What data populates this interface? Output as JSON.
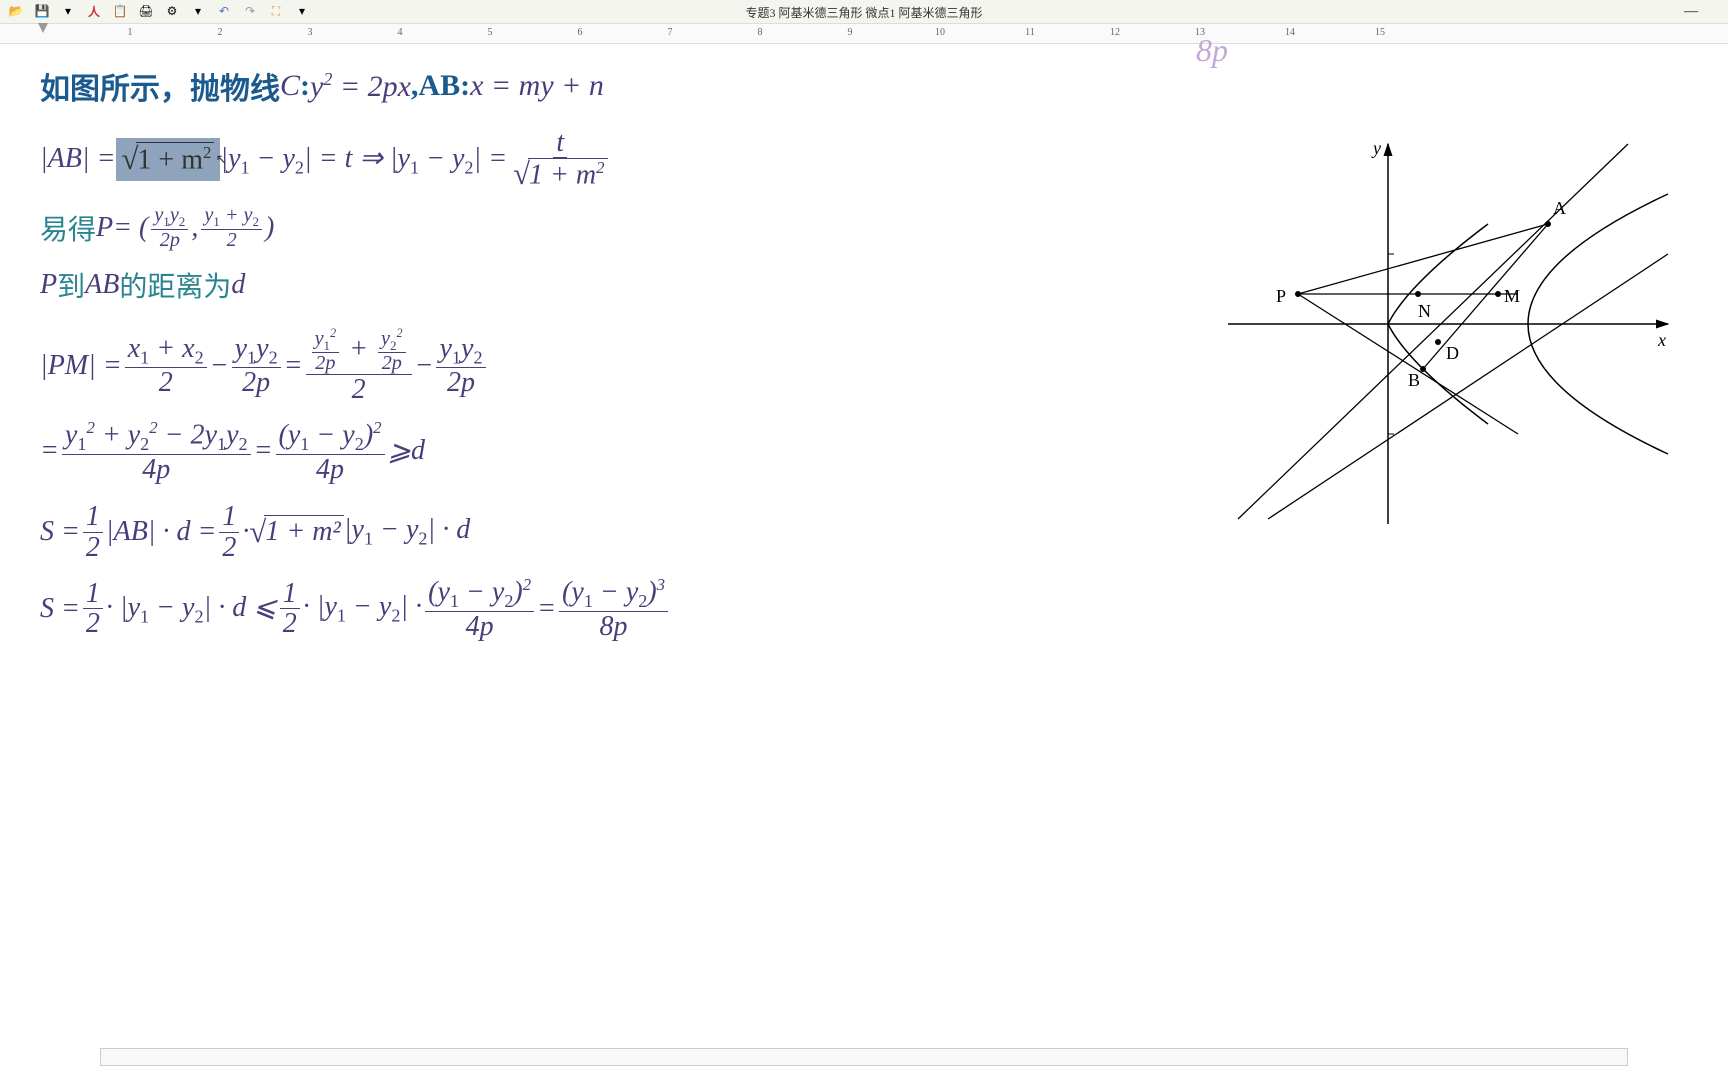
{
  "app": {
    "title": "专题3 阿基米德三角形 微点1 阿基米德三角形",
    "minimize": "—"
  },
  "toolbar": {
    "open": "📂",
    "save": "💾",
    "pdf": "人",
    "copy": "📋",
    "print": "🖨",
    "settings": "⚙",
    "undo": "↶",
    "redo": "↷",
    "expand": "⛶",
    "dropdown": "▾"
  },
  "ruler": {
    "marks": [
      "1",
      "2",
      "3",
      "4",
      "5",
      "6",
      "7",
      "8",
      "9",
      "10",
      "11",
      "12",
      "13",
      "14",
      "15"
    ],
    "offsets": [
      130,
      220,
      310,
      400,
      490,
      580,
      670,
      760,
      850,
      940,
      1030,
      1115,
      1200,
      1290,
      1380
    ]
  },
  "fade": "8p",
  "line1": {
    "prefix": "如图所示，抛物线 ",
    "c_label": "C",
    "colon1": ": ",
    "eq1a": "y",
    "eq1b": " = 2px",
    "sep": ", ",
    "ab": "AB",
    "colon2": ": ",
    "eq2": "x = my + n"
  },
  "line2": {
    "ab": "|AB| = ",
    "root": "1 + m",
    "mid": "|y",
    "dash": " − y",
    "eq": "| = t ⇒ |y",
    "dash2": " − y",
    "end": "| = ",
    "num": "t",
    "den_root": "1 + m"
  },
  "line3": {
    "prefix": "易得 ",
    "p": "P",
    "open": " = (",
    "n1": "y₁y₂",
    "d1": "2p",
    "comma": ", ",
    "n2": "y₁ + y₂",
    "d2": "2",
    "close": ")"
  },
  "line4": {
    "p": "P",
    "mid": " 到 ",
    "ab": "AB",
    "suffix": " 的距离为 ",
    "d": "d"
  },
  "line5": {
    "pm": "|PM| = ",
    "n1": "x₁ + x₂",
    "d1": "2",
    "minus": " − ",
    "n2": "y₁y₂",
    "d2": "2p",
    "eq": " = ",
    "nn1": "y₁²",
    "nd1": "2p",
    "plus": " + ",
    "nn2": "y₂²",
    "nd2": "2p",
    "dd": "2",
    "minus2": " − ",
    "n3": "y₁y₂",
    "d3": "2p"
  },
  "line6": {
    "eq": "= ",
    "n1": "y₁² + y₂² − 2y₁y₂",
    "d1": "4p",
    "eq2": " = ",
    "n2": "(y₁ − y₂)²",
    "d2": "4p",
    "ge": " ⩾ ",
    "d": "d"
  },
  "line7": {
    "s": "S = ",
    "half_n": "1",
    "half_d": "2",
    "ab": "|AB| · d = ",
    "half2_n": "1",
    "half2_d": "2",
    "dot": " · ",
    "root": "1 + m²",
    "yy": "|y₁ − y₂| · d"
  },
  "line8": {
    "s": "S = ",
    "half_n": "1",
    "half_d": "2",
    "dot": " · |y₁ − y₂| · d ⩽ ",
    "half2_n": "1",
    "half2_d": "2",
    "dot2": " · |y₁ − y₂| · ",
    "n1": "(y₁ − y₂)²",
    "d1": "4p",
    "eq": " = ",
    "n2": "(y₁ − y₂)³",
    "d2": "8p"
  },
  "diagram": {
    "labels": {
      "y": "y",
      "x": "x",
      "A": "A",
      "B": "B",
      "P": "P",
      "N": "N",
      "M": "M",
      "D": "D"
    }
  }
}
